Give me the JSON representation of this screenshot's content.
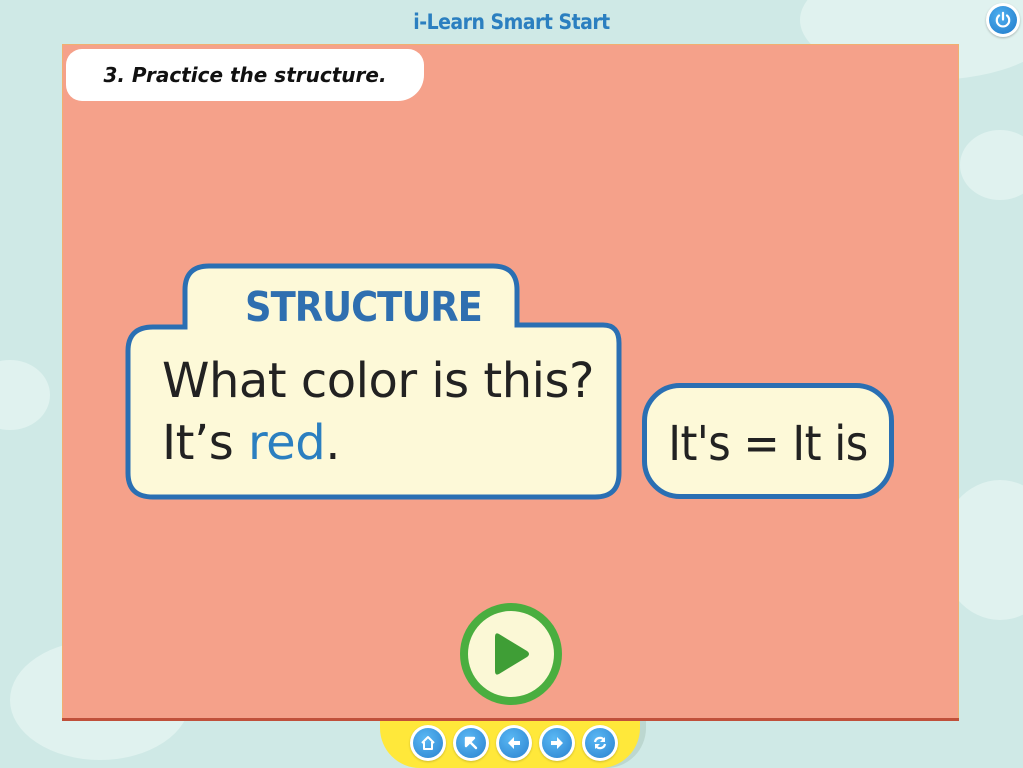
{
  "app": {
    "title": "i-Learn Smart Start"
  },
  "instruction": "3. Practice the structure.",
  "structure": {
    "label": "STRUCTURE",
    "question": "What color is this?",
    "answer_prefix": "It’s ",
    "answer_highlight": "red",
    "answer_suffix": "."
  },
  "note": "It's = It is",
  "icons": {
    "power": "power-icon",
    "play": "play-icon",
    "nav": [
      "home-icon",
      "arrow-up-left-icon",
      "arrow-left-icon",
      "arrow-right-icon",
      "refresh-icon"
    ]
  },
  "colors": {
    "stage": "#f5a18a",
    "card_bg": "#fdf9d8",
    "card_border": "#2a6fb3",
    "accent": "#2b7fc0",
    "play_green": "#4aae3f",
    "nav_tray": "#ffe83a"
  }
}
